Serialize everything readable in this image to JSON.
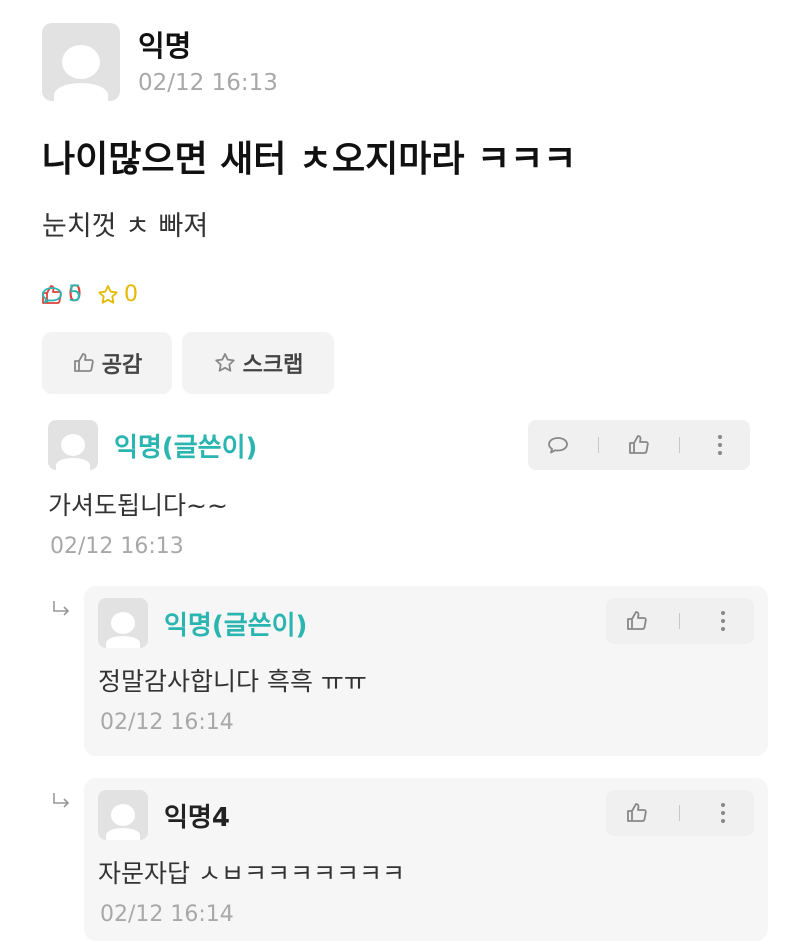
{
  "post": {
    "author": "익명",
    "time": "02/12 16:13",
    "title": "나이많으면 새터 ㅊ오지마라 ㅋㅋㅋ",
    "body": "눈치껏 ㅊ 빠져",
    "stats": {
      "likes": "0",
      "comments": "5",
      "scraps": "0"
    },
    "actions": {
      "empathy": "공감",
      "scrap": "스크랩"
    }
  },
  "comments": [
    {
      "author": "익명(글쓴이)",
      "text": "가셔도됩니다~~",
      "time": "02/12 16:13"
    }
  ],
  "replies": [
    {
      "author": "익명(글쓴이)",
      "text": "정말감사합니다 흑흑 ㅠㅠ",
      "time": "02/12 16:14"
    },
    {
      "author": "익명4",
      "text": "자문자답 ㅅㅂㅋㅋㅋㅋㅋㅋㅋ",
      "time": "02/12 16:14"
    }
  ],
  "colors": {
    "accent_teal": "#2bb5b0",
    "like_red": "#e0413a",
    "scrap_yellow": "#e6b800",
    "meta_gray": "#a8a8a8"
  },
  "icons": [
    "thumbs-up-icon",
    "speech-bubble-icon",
    "star-icon",
    "kebab-menu-icon",
    "reply-arrow-icon",
    "default-avatar-icon"
  ]
}
